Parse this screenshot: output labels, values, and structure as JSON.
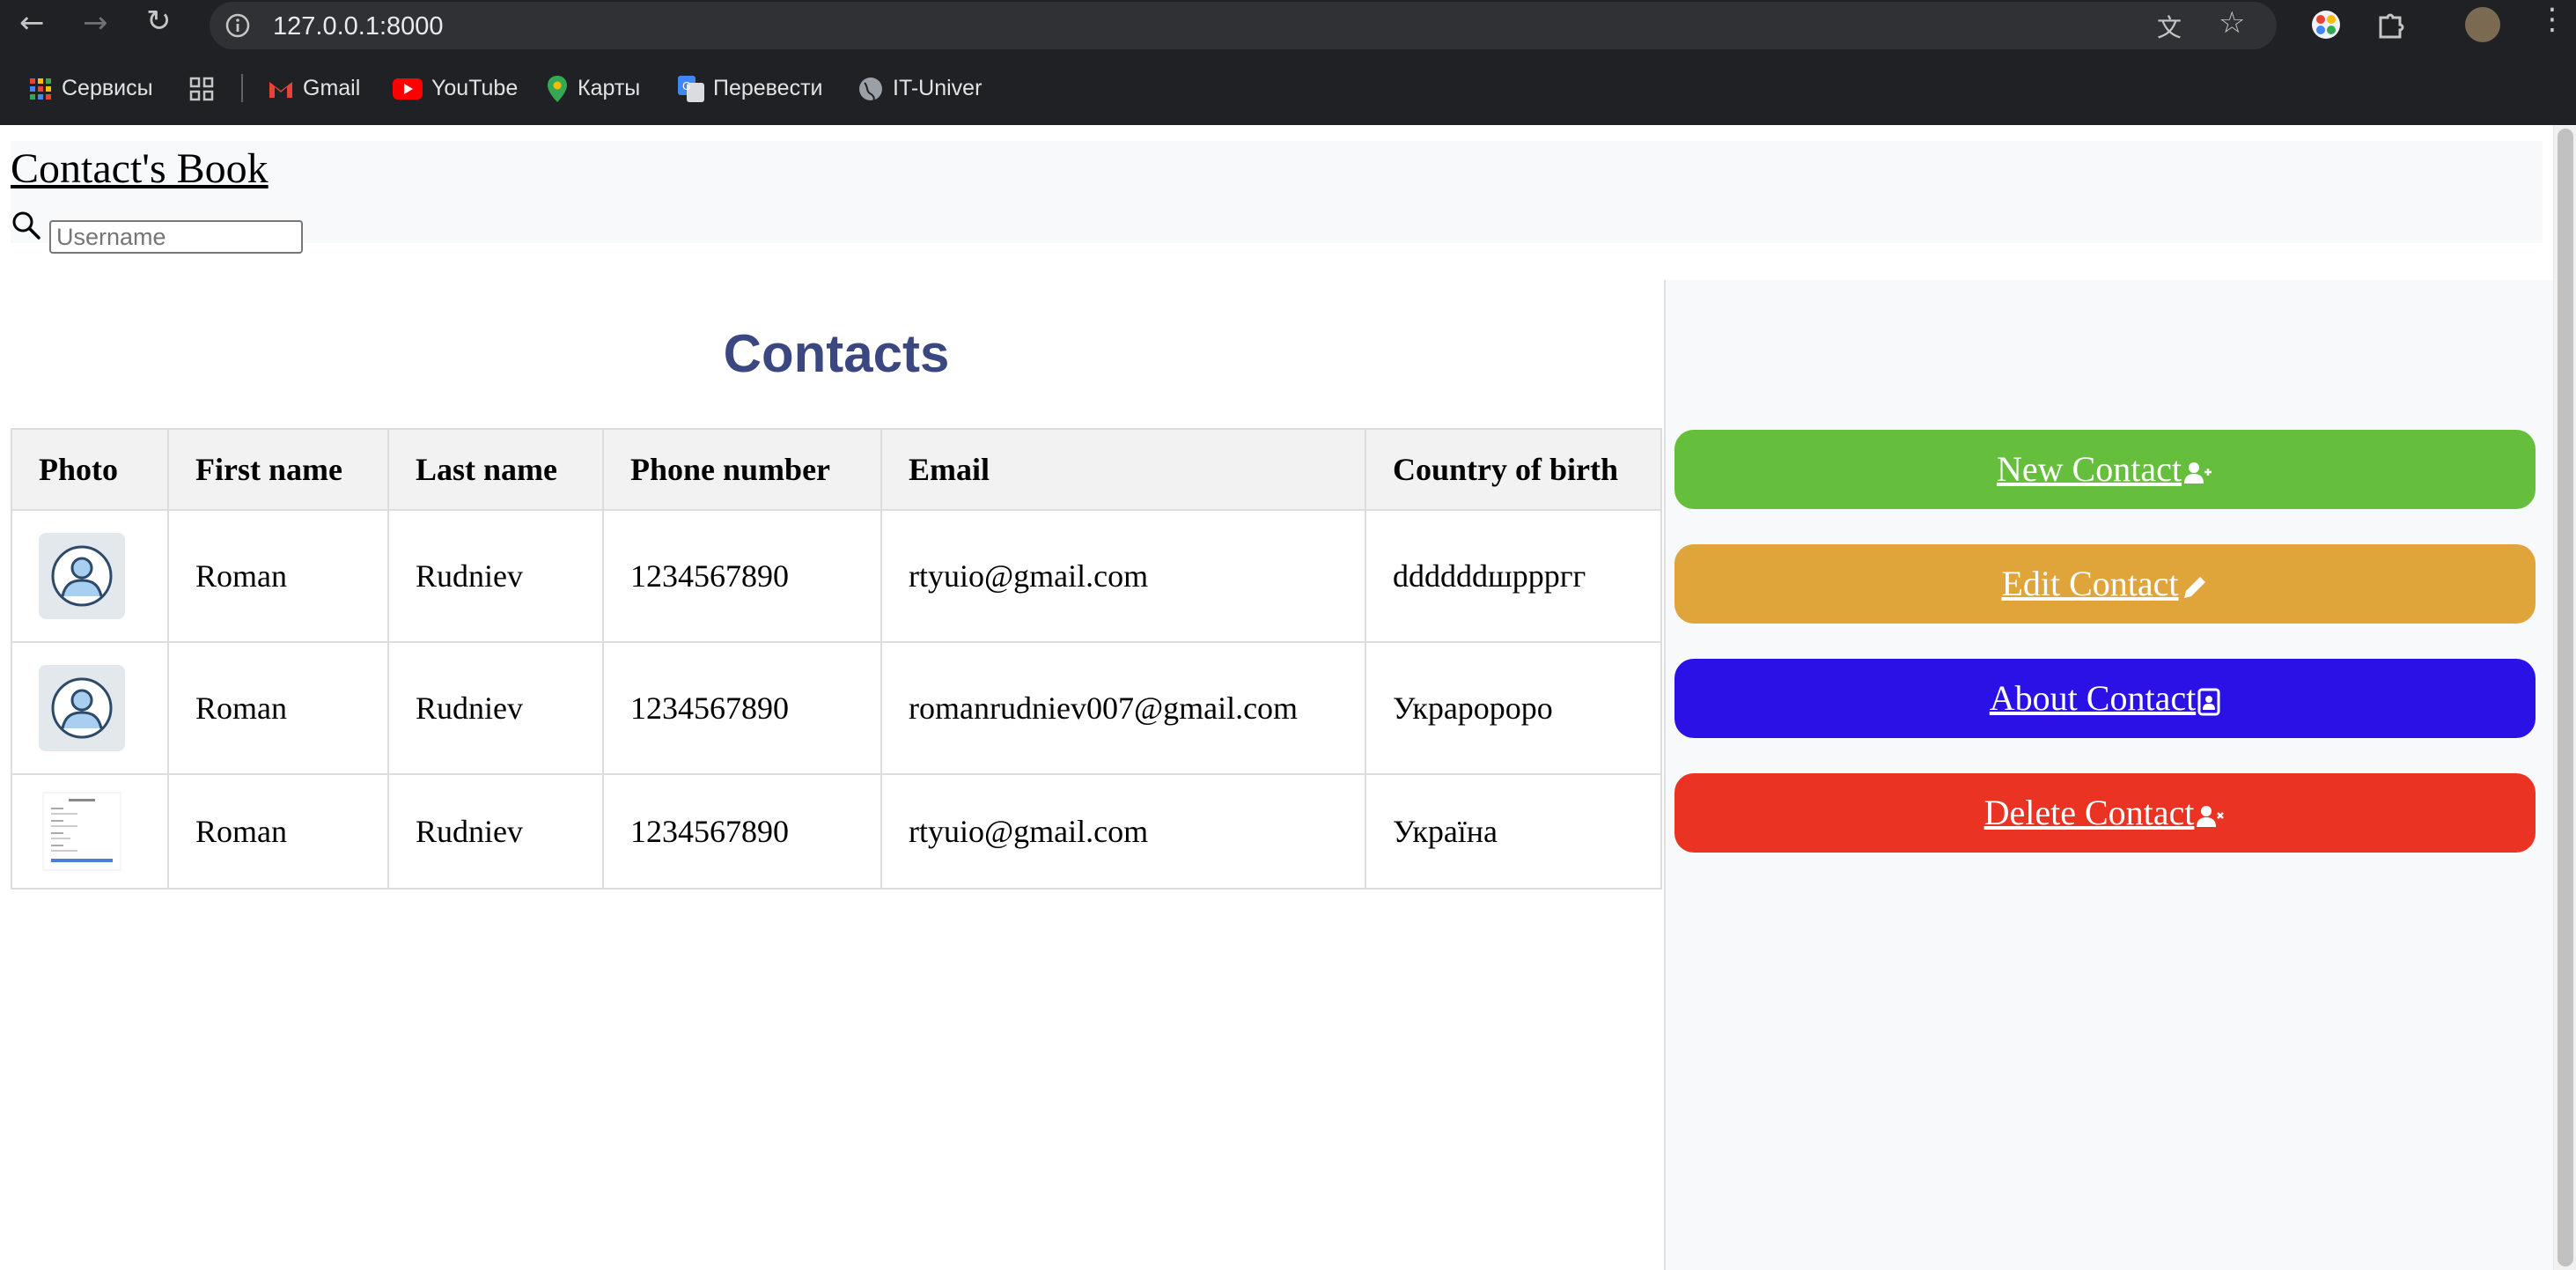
{
  "browser": {
    "url": "127.0.0.1:8000",
    "bookmarks": [
      {
        "label": "Сервисы",
        "icon": "apps-grid-icon"
      },
      {
        "label": "Gmail",
        "icon": "gmail-icon"
      },
      {
        "label": "YouTube",
        "icon": "youtube-icon"
      },
      {
        "label": "Карты",
        "icon": "maps-icon"
      },
      {
        "label": "Перевести",
        "icon": "translate-icon"
      },
      {
        "label": "IT-Univer",
        "icon": "globe-icon"
      }
    ]
  },
  "navbar": {
    "brand": "Contact's Book",
    "search_placeholder": "Username"
  },
  "main": {
    "title": "Contacts",
    "columns": [
      "Photo",
      "First name",
      "Last name",
      "Phone number",
      "Email",
      "Country of birth"
    ],
    "rows": [
      {
        "photo": "default-avatar",
        "first_name": "Roman",
        "last_name": "Rudniev",
        "phone": "1234567890",
        "email": "rtyuio@gmail.com",
        "country": "ddddddшррргг"
      },
      {
        "photo": "default-avatar",
        "first_name": "Roman",
        "last_name": "Rudniev",
        "phone": "1234567890",
        "email": "romanrudniev007@gmail.com",
        "country": "Украророро"
      },
      {
        "photo": "document-thumbnail",
        "first_name": "Roman",
        "last_name": "Rudniev",
        "phone": "1234567890",
        "email": "rtyuio@gmail.com",
        "country": "Україна"
      }
    ]
  },
  "sidebar": {
    "buttons": [
      {
        "label": "New Contact",
        "icon": "user-plus-icon",
        "color": "#66bf3c"
      },
      {
        "label": "Edit Contact",
        "icon": "pencil-icon",
        "color": "#e0a53a"
      },
      {
        "label": "About Contact",
        "icon": "contact-card-icon",
        "color": "#2a12e6"
      },
      {
        "label": "Delete Contact",
        "icon": "user-remove-icon",
        "color": "#ea3323"
      }
    ]
  }
}
